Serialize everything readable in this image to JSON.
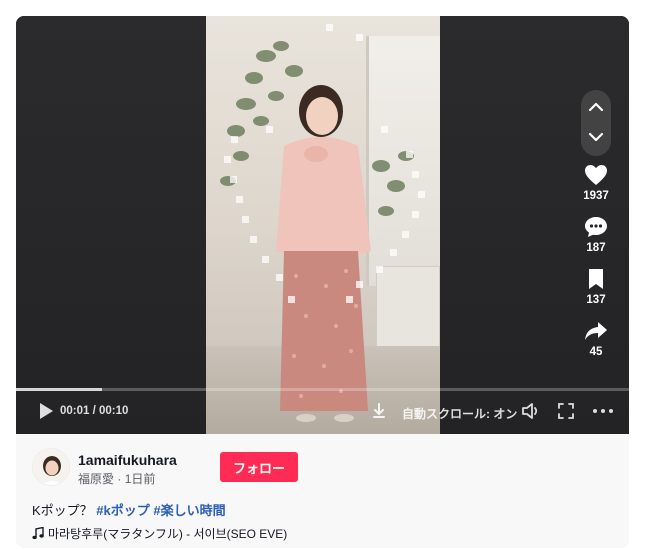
{
  "video": {
    "time_display": "00:01 / 00:10",
    "progress_fraction": 0.14,
    "autoscroll_label": "自動スクロール: オン"
  },
  "actions": {
    "likes": "1937",
    "comments": "187",
    "saves": "137",
    "shares": "45"
  },
  "author": {
    "username": "1amaifukuhara",
    "display_name": "福原愛",
    "separator": " · ",
    "posted": "1日前"
  },
  "follow_label": "フォロー",
  "caption": {
    "text": "Kポップ？",
    "hashtags": [
      "#kポップ",
      "#楽しい時間"
    ]
  },
  "music": {
    "icon": "music-note-icon",
    "title": "마라탕후루(マラタンフル) - 서이브(SEO EVE)"
  },
  "colors": {
    "follow_button": "#fe2c55",
    "hashtag": "#2b5db9",
    "player_bg": "#27272a"
  }
}
